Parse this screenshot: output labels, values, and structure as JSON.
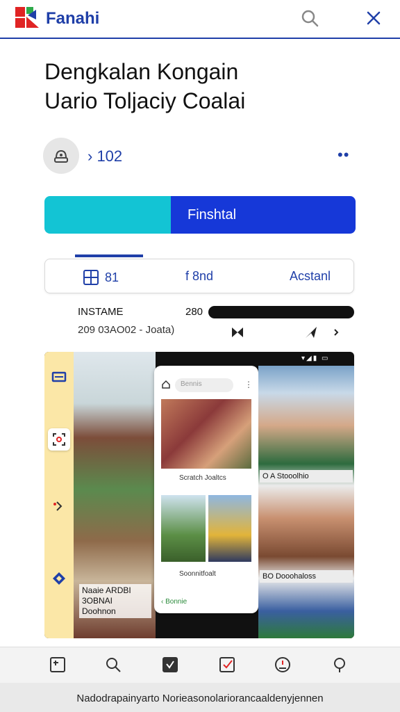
{
  "header": {
    "brand": "Fanahi",
    "logo_icon": "brand-logo-icon",
    "search_icon": "search-icon",
    "close_icon": "close-icon",
    "accent": "#1f3fa8"
  },
  "app": {
    "title_line1": "Dengkalan Kongain",
    "title_line2": "Uario Toljaciy Coalai",
    "rating_count": "› 102",
    "more_label": "••"
  },
  "actions": {
    "primary_label": "Finshtal",
    "primary_color": "#1638d8",
    "secondary_color": "#13c4d4"
  },
  "tabs": [
    {
      "label": "81",
      "icon": "grid-icon"
    },
    {
      "label": "f 8nd"
    },
    {
      "label": "Acstanl"
    }
  ],
  "install": {
    "label": "INSTAME",
    "value": "280",
    "date": "209 03AO02 - Joata)"
  },
  "preview": {
    "left_caption": "Naaie ARDBI\n3OBNAI\nDoohnon",
    "phone_search_placeholder": "Bennis",
    "phone_caption_1": "Scratch Joaltcs",
    "phone_caption_2": "Soonnitfoalt",
    "phone_back": "‹ Bonnie",
    "status": "▾◢▮ ▭",
    "right_caption_1": "O A Stooolhio",
    "right_caption_2": "BO Dooohaloss"
  },
  "bottom_nav": [
    {
      "icon": "home-icon"
    },
    {
      "icon": "search-icon"
    },
    {
      "icon": "verified-icon"
    },
    {
      "icon": "checkbox-icon"
    },
    {
      "icon": "profile-icon"
    },
    {
      "icon": "bulb-icon"
    }
  ],
  "footer": {
    "text": "Nadodrapainyarto Norieasonolariorancaaldenyjennen"
  }
}
